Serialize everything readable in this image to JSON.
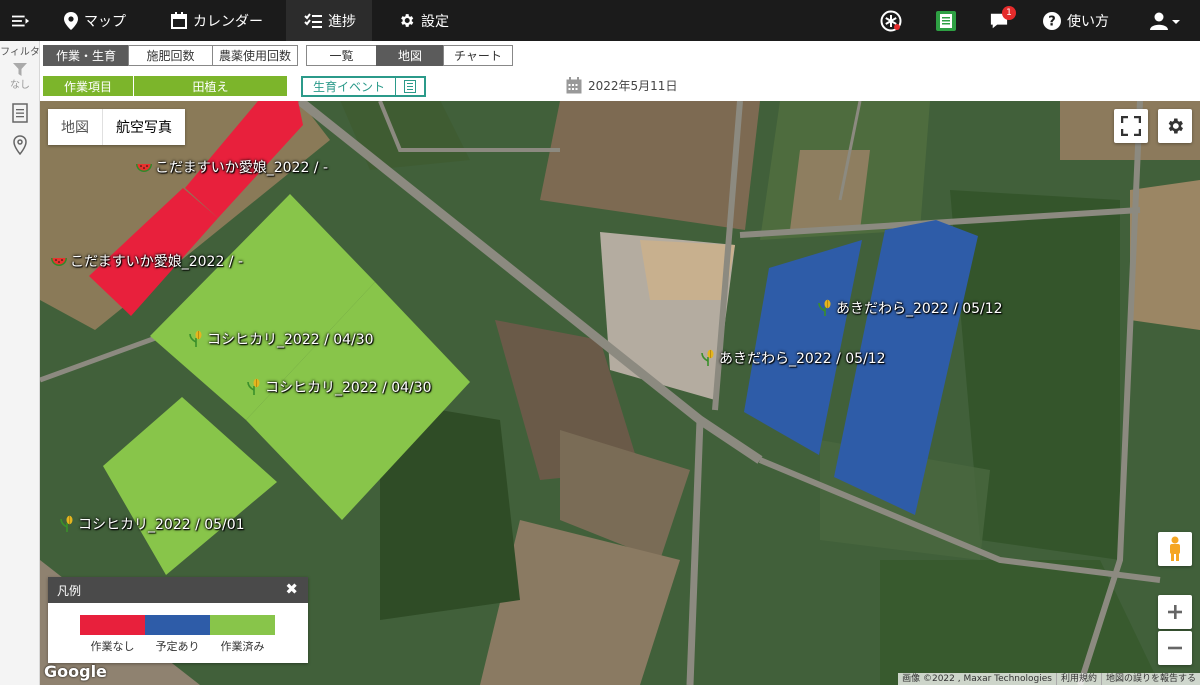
{
  "nav": {
    "items": [
      {
        "label": "マップ",
        "icon": "map-pin-icon"
      },
      {
        "label": "カレンダー",
        "icon": "calendar-icon"
      },
      {
        "label": "進捗",
        "icon": "checklist-icon"
      },
      {
        "label": "設定",
        "icon": "gear-icon"
      }
    ],
    "active": "進捗",
    "notification_count": "1",
    "help_label": "使い方"
  },
  "rail": {
    "filter_label": "フィルタ",
    "filter_state": "なし"
  },
  "category_tabs": [
    "作業・生育",
    "施肥回数",
    "農薬使用回数"
  ],
  "category_selected": "作業・生育",
  "view_tabs": [
    "一覧",
    "地図",
    "チャート"
  ],
  "view_selected": "地図",
  "work_item": {
    "label": "作業項目",
    "value": "田植え"
  },
  "event_button": "生育イベント",
  "date": "2022年5月11日",
  "map": {
    "type_options": [
      "地図",
      "航空写真"
    ],
    "type_selected": "航空写真",
    "field_labels": [
      "こだますいか愛娘_2022 / -",
      "こだますいか愛娘_2022 / -",
      "コシヒカリ_2022 / 04/30",
      "コシヒカリ_2022 / 04/30",
      "コシヒカリ_2022 / 05/01",
      "あきだわら_2022 / 05/12",
      "あきだわら_2022 / 05/12"
    ],
    "brand": "Google",
    "attribution": [
      "画像 ©2022 , Maxar Technologies",
      "利用規約",
      "地図の誤りを報告する"
    ]
  },
  "legend": {
    "title": "凡例",
    "items": [
      {
        "label": "作業なし",
        "color": "#e8203c"
      },
      {
        "label": "予定あり",
        "color": "#2e5ca8"
      },
      {
        "label": "作業済み",
        "color": "#88c54a"
      }
    ]
  },
  "colors": {
    "topbar": "#1b1b1b",
    "accent_green": "#7cb52b",
    "event_teal": "#2b9a8a"
  }
}
